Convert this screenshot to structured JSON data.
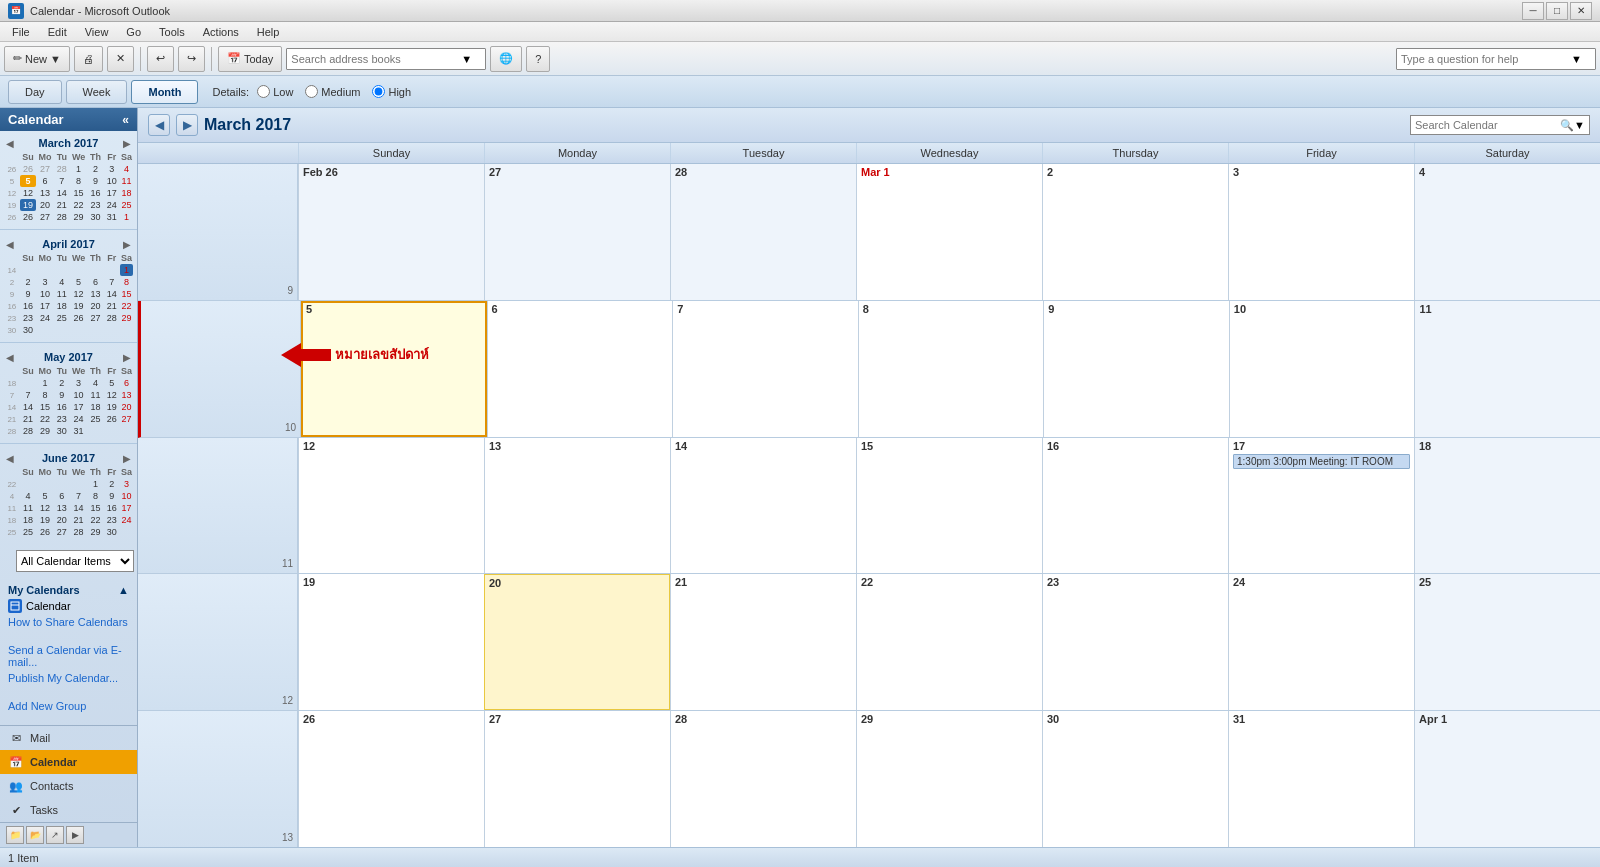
{
  "window": {
    "title": "Calendar - Microsoft Outlook",
    "minimize": "─",
    "restore": "□",
    "close": "✕"
  },
  "menubar": {
    "items": [
      "File",
      "Edit",
      "View",
      "Go",
      "Tools",
      "Actions",
      "Help"
    ]
  },
  "toolbar": {
    "new_label": "New ▼",
    "today_label": "Today",
    "search_placeholder": "Search address books",
    "today_icon": "📅"
  },
  "nav": {
    "day_label": "Day",
    "week_label": "Week",
    "month_label": "Month",
    "details_label": "Details:",
    "low_label": "Low",
    "medium_label": "Medium",
    "high_label": "High"
  },
  "calendar_header": {
    "title": "March 2017",
    "search_placeholder": "Search Calendar"
  },
  "day_headers": [
    "Sunday",
    "Monday",
    "Tuesday",
    "Wednesday",
    "Thursday",
    "Friday",
    "Saturday"
  ],
  "weeks": [
    {
      "week_num": "9",
      "days": [
        {
          "label": "Feb 26",
          "date": 26,
          "month": "Feb",
          "other": true
        },
        {
          "label": "27",
          "date": 27,
          "other": true
        },
        {
          "label": "28",
          "date": 28,
          "other": true
        },
        {
          "label": "Mar 1",
          "date": 1,
          "month": "Mar",
          "start": true
        },
        {
          "label": "2",
          "date": 2
        },
        {
          "label": "3",
          "date": 3
        },
        {
          "label": "4",
          "date": 4
        }
      ]
    },
    {
      "week_num": "10",
      "days": [
        {
          "label": "5",
          "date": 5,
          "today": true
        },
        {
          "label": "6",
          "date": 6
        },
        {
          "label": "7",
          "date": 7
        },
        {
          "label": "8",
          "date": 8
        },
        {
          "label": "9",
          "date": 9
        },
        {
          "label": "10",
          "date": 10
        },
        {
          "label": "11",
          "date": 11
        }
      ],
      "annotation": {
        "text": "หมายเลขสัปดาห์",
        "week_label": "10"
      }
    },
    {
      "week_num": "11",
      "days": [
        {
          "label": "12",
          "date": 12
        },
        {
          "label": "13",
          "date": 13
        },
        {
          "label": "14",
          "date": 14
        },
        {
          "label": "15",
          "date": 15
        },
        {
          "label": "16",
          "date": 16
        },
        {
          "label": "17",
          "date": 17,
          "events": [
            "1:30pm  3:00pm  Meeting: IT ROOM"
          ]
        },
        {
          "label": "18",
          "date": 18
        }
      ]
    },
    {
      "week_num": "12",
      "days": [
        {
          "label": "19",
          "date": 19
        },
        {
          "label": "20",
          "date": 20,
          "highlighted": true
        },
        {
          "label": "21",
          "date": 21
        },
        {
          "label": "22",
          "date": 22
        },
        {
          "label": "23",
          "date": 23
        },
        {
          "label": "24",
          "date": 24
        },
        {
          "label": "25",
          "date": 25
        }
      ]
    },
    {
      "week_num": "13",
      "days": [
        {
          "label": "26",
          "date": 26
        },
        {
          "label": "27",
          "date": 27
        },
        {
          "label": "28",
          "date": 28
        },
        {
          "label": "29",
          "date": 29
        },
        {
          "label": "30",
          "date": 30
        },
        {
          "label": "31",
          "date": 31
        },
        {
          "label": "Apr 1",
          "date": 1,
          "month": "Apr",
          "other": true
        }
      ]
    }
  ],
  "mini_calendars": [
    {
      "title": "March 2017",
      "month": 2,
      "year": 2017,
      "headers": [
        "Su",
        "Mo",
        "Tu",
        "We",
        "Th",
        "Fr",
        "Sa"
      ],
      "rows": [
        {
          "week": "26",
          "days": [
            [
              "26",
              "om"
            ],
            [
              "27",
              "om"
            ],
            [
              "28",
              "om"
            ],
            [
              "1",
              ""
            ],
            [
              "2",
              ""
            ],
            [
              "3",
              ""
            ],
            [
              "4",
              ""
            ]
          ]
        },
        {
          "week": "5",
          "days": [
            [
              "5",
              "today"
            ],
            [
              "6",
              ""
            ],
            [
              "7",
              ""
            ],
            [
              "8",
              ""
            ],
            [
              "9",
              ""
            ],
            [
              "10",
              ""
            ],
            [
              "11",
              ""
            ]
          ]
        },
        {
          "week": "12",
          "days": [
            [
              "12",
              ""
            ],
            [
              "13",
              ""
            ],
            [
              "14",
              ""
            ],
            [
              "15",
              ""
            ],
            [
              "16",
              ""
            ],
            [
              "17",
              ""
            ],
            [
              "18",
              ""
            ]
          ]
        },
        {
          "week": "19",
          "days": [
            [
              "19",
              "sel"
            ],
            [
              "20",
              ""
            ],
            [
              "21",
              ""
            ],
            [
              "22",
              ""
            ],
            [
              "23",
              ""
            ],
            [
              "24",
              ""
            ],
            [
              "25",
              ""
            ]
          ]
        },
        {
          "week": "26",
          "days": [
            [
              "26",
              ""
            ],
            [
              "27",
              ""
            ],
            [
              "28",
              ""
            ],
            [
              "29",
              ""
            ],
            [
              "30",
              ""
            ],
            [
              "31",
              ""
            ],
            [
              "1",
              "om"
            ]
          ]
        }
      ]
    },
    {
      "title": "April 2017",
      "headers": [
        "Su",
        "Mo",
        "Tu",
        "We",
        "Th",
        "Fr",
        "Sa"
      ],
      "rows": [
        {
          "week": "14",
          "days": [
            [
              "",
              ""
            ],
            [
              "",
              ""
            ],
            [
              "",
              ""
            ],
            [
              "",
              ""
            ],
            [
              "",
              ""
            ],
            [
              "",
              ""
            ],
            [
              "1",
              "sel"
            ]
          ]
        },
        {
          "week": "2",
          "days": [
            [
              "2",
              ""
            ],
            [
              "3",
              ""
            ],
            [
              "4",
              ""
            ],
            [
              "5",
              ""
            ],
            [
              "6",
              ""
            ],
            [
              "7",
              ""
            ],
            [
              "8",
              ""
            ]
          ]
        },
        {
          "week": "9",
          "days": [
            [
              "9",
              ""
            ],
            [
              "10",
              ""
            ],
            [
              "11",
              ""
            ],
            [
              "12",
              ""
            ],
            [
              "13",
              ""
            ],
            [
              "14",
              ""
            ],
            [
              "15",
              ""
            ]
          ]
        },
        {
          "week": "16",
          "days": [
            [
              "16",
              ""
            ],
            [
              "17",
              ""
            ],
            [
              "18",
              ""
            ],
            [
              "19",
              ""
            ],
            [
              "20",
              ""
            ],
            [
              "21",
              ""
            ],
            [
              "22",
              ""
            ]
          ]
        },
        {
          "week": "23",
          "days": [
            [
              "23",
              ""
            ],
            [
              "24",
              ""
            ],
            [
              "25",
              ""
            ],
            [
              "26",
              ""
            ],
            [
              "27",
              ""
            ],
            [
              "28",
              ""
            ],
            [
              "29",
              ""
            ]
          ]
        },
        {
          "week": "30",
          "days": [
            [
              "30",
              ""
            ],
            [
              "",
              ""
            ],
            [
              "",
              ""
            ],
            [
              "",
              ""
            ],
            [
              "",
              ""
            ],
            [
              "",
              ""
            ],
            [
              "",
              ""
            ]
          ]
        }
      ]
    },
    {
      "title": "May 2017",
      "headers": [
        "Su",
        "Mo",
        "Tu",
        "We",
        "Th",
        "Fr",
        "Sa"
      ],
      "rows": [
        {
          "week": "18",
          "days": [
            [
              "",
              ""
            ],
            [
              "1",
              ""
            ],
            [
              "2",
              ""
            ],
            [
              "3",
              ""
            ],
            [
              "4",
              ""
            ],
            [
              "5",
              ""
            ],
            [
              "6",
              ""
            ]
          ]
        },
        {
          "week": "7",
          "days": [
            [
              "7",
              ""
            ],
            [
              "8",
              ""
            ],
            [
              "9",
              ""
            ],
            [
              "10",
              ""
            ],
            [
              "11",
              ""
            ],
            [
              "12",
              ""
            ],
            [
              "13",
              ""
            ]
          ]
        },
        {
          "week": "14",
          "days": [
            [
              "14",
              ""
            ],
            [
              "15",
              ""
            ],
            [
              "16",
              ""
            ],
            [
              "17",
              ""
            ],
            [
              "18",
              ""
            ],
            [
              "19",
              ""
            ],
            [
              "20",
              ""
            ]
          ]
        },
        {
          "week": "21",
          "days": [
            [
              "21",
              ""
            ],
            [
              "22",
              ""
            ],
            [
              "23",
              ""
            ],
            [
              "24",
              ""
            ],
            [
              "25",
              ""
            ],
            [
              "26",
              ""
            ],
            [
              "27",
              ""
            ]
          ]
        },
        {
          "week": "28",
          "days": [
            [
              "28",
              ""
            ],
            [
              "29",
              ""
            ],
            [
              "30",
              ""
            ],
            [
              "31",
              ""
            ],
            [
              "",
              ""
            ],
            [
              "",
              ""
            ],
            [
              "",
              ""
            ]
          ]
        }
      ]
    },
    {
      "title": "June 2017",
      "headers": [
        "Su",
        "Mo",
        "Tu",
        "We",
        "Th",
        "Fr",
        "Sa"
      ],
      "rows": [
        {
          "week": "22",
          "days": [
            [
              "",
              ""
            ],
            [
              "",
              ""
            ],
            [
              "",
              ""
            ],
            [
              "",
              ""
            ],
            [
              "1",
              ""
            ],
            [
              "2",
              ""
            ],
            [
              "3",
              ""
            ]
          ]
        },
        {
          "week": "4",
          "days": [
            [
              "4",
              ""
            ],
            [
              "5",
              ""
            ],
            [
              "6",
              ""
            ],
            [
              "7",
              ""
            ],
            [
              "8",
              ""
            ],
            [
              "9",
              ""
            ],
            [
              "10",
              ""
            ]
          ]
        },
        {
          "week": "11",
          "days": [
            [
              "11",
              ""
            ],
            [
              "12",
              ""
            ],
            [
              "13",
              ""
            ],
            [
              "14",
              ""
            ],
            [
              "15",
              ""
            ],
            [
              "16",
              ""
            ],
            [
              "17",
              ""
            ]
          ]
        },
        {
          "week": "18",
          "days": [
            [
              "18",
              ""
            ],
            [
              "19",
              ""
            ],
            [
              "20",
              ""
            ],
            [
              "21",
              ""
            ],
            [
              "22",
              ""
            ],
            [
              "23",
              ""
            ],
            [
              "24",
              ""
            ]
          ]
        },
        {
          "week": "25",
          "days": [
            [
              "25",
              ""
            ],
            [
              "26",
              ""
            ],
            [
              "27",
              ""
            ],
            [
              "28",
              ""
            ],
            [
              "29",
              ""
            ],
            [
              "30",
              ""
            ],
            [
              "",
              ""
            ]
          ]
        }
      ]
    }
  ],
  "sidebar": {
    "title": "Calendar",
    "all_calendars_label": "All Calendar Items",
    "my_calendars_label": "My Calendars",
    "calendar_item_label": "Calendar",
    "share_link": "How to Share Calendars",
    "send_link": "Send a Calendar via E-mail...",
    "publish_link": "Publish My Calendar...",
    "add_group": "Add New Group"
  },
  "nav_items": [
    {
      "label": "Mail",
      "icon": "✉",
      "active": false
    },
    {
      "label": "Calendar",
      "icon": "📅",
      "active": true
    },
    {
      "label": "Contacts",
      "icon": "👥",
      "active": false
    },
    {
      "label": "Tasks",
      "icon": "✔",
      "active": false
    }
  ],
  "status_bar": {
    "text": "1 Item"
  },
  "colors": {
    "accent": "#1a6db5",
    "today_bg": "#f0a000",
    "selected_bg": "#fef8e0",
    "event_bg": "#c5d9f1",
    "header_bg": "#dce9f5",
    "sidebar_bg": "#c8d8ea",
    "red": "#cc0000"
  }
}
